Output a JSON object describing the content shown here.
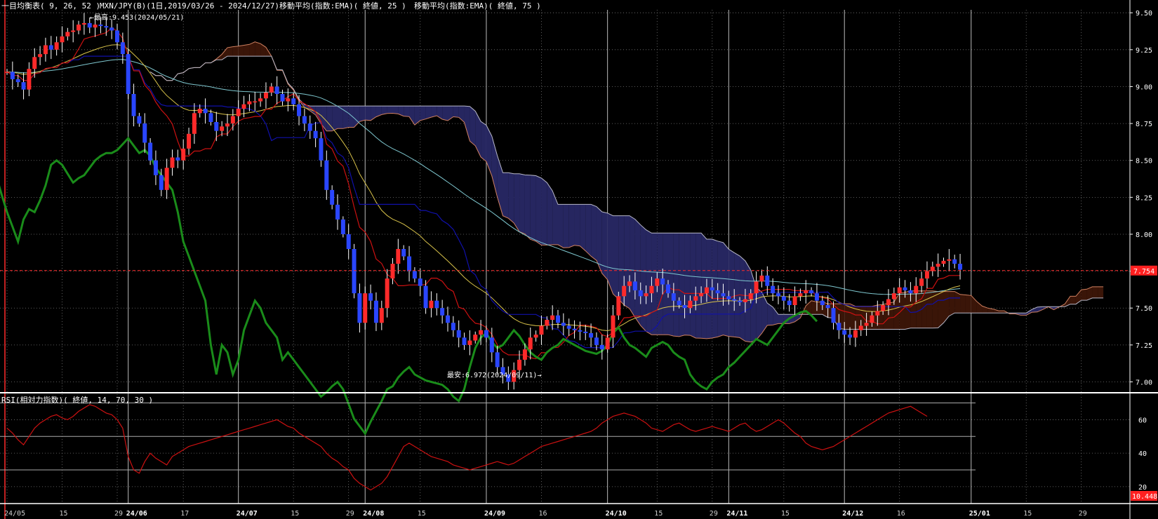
{
  "header": {
    "ichimoku_label": "一目均衡表( 9, 26, 52 )",
    "symbol_label": "MXN/JPY(B)(1日,2019/03/26 - 2024/12/27)",
    "ema25_label": "移動平均(指数:EMA)( 終値, 25 )",
    "ema75_label": "移動平均(指数:EMA)( 終値, 75 )"
  },
  "annotations": {
    "high_label": "←最高:9.453(2024/05/21)",
    "low_label": "最安:6.972(2024/09/11)→"
  },
  "price_badge": "7.754",
  "rsi_header": "RSI(相対力指数)( 終値, 14, 70, 30 )",
  "rsi_badge": "10.448",
  "colors": {
    "background": "#000000",
    "up_candle": "#ff2a2a",
    "down_candle": "#2a46ff",
    "chikou": "#1a8c1a",
    "tenkan": "#cc1111",
    "kijun": "#1010aa",
    "ema25": "#d8c24a",
    "ema75": "#7fc8d0",
    "cloud_bull": "#3a1508",
    "cloud_bear": "#262660",
    "span_a": "#d08060",
    "span_b": "#b8b8c8",
    "rsi_line": "#cc1111",
    "current_price": "#ff2a2a"
  },
  "chart_data": [
    {
      "type": "candlestick",
      "name": "MXN/JPY daily",
      "y_ticks": [
        "9.50",
        "9.25",
        "9.00",
        "8.75",
        "8.50",
        "8.25",
        "8.00",
        "7.75",
        "7.50",
        "7.25",
        "7.00"
      ],
      "ylim": [
        6.95,
        9.52
      ],
      "x_ticks": [
        {
          "label": "24/05",
          "i": 0
        },
        {
          "label": "15",
          "i": 10
        },
        {
          "label": "29",
          "i": 20
        },
        {
          "label": "24/06",
          "i": 22
        },
        {
          "label": "17",
          "i": 32
        },
        {
          "label": "24/07",
          "i": 42
        },
        {
          "label": "15",
          "i": 52
        },
        {
          "label": "29",
          "i": 62
        },
        {
          "label": "24/08",
          "i": 65
        },
        {
          "label": "15",
          "i": 75
        },
        {
          "label": "24/09",
          "i": 87
        },
        {
          "label": "16",
          "i": 97
        },
        {
          "label": "24/10",
          "i": 109
        },
        {
          "label": "15",
          "i": 118
        },
        {
          "label": "29",
          "i": 128
        },
        {
          "label": "24/11",
          "i": 131
        },
        {
          "label": "15",
          "i": 141
        },
        {
          "label": "24/12",
          "i": 152
        },
        {
          "label": "16",
          "i": 162
        },
        {
          "label": "25/01",
          "i": 175
        },
        {
          "label": "15",
          "i": 185
        },
        {
          "label": "29",
          "i": 195
        }
      ],
      "month_boundaries": [
        22,
        42,
        65,
        87,
        109,
        131,
        152,
        175
      ],
      "current_price": 7.754,
      "high": {
        "value": 9.453,
        "date": "2024/05/21"
      },
      "low": {
        "value": 6.972,
        "date": "2024/09/11"
      },
      "close": [
        9.1,
        9.05,
        9.03,
        8.98,
        9.12,
        9.2,
        9.22,
        9.28,
        9.25,
        9.3,
        9.34,
        9.37,
        9.38,
        9.42,
        9.43,
        9.4,
        9.42,
        9.41,
        9.4,
        9.38,
        9.3,
        9.22,
        8.95,
        8.8,
        8.75,
        8.62,
        8.5,
        8.4,
        8.3,
        8.45,
        8.52,
        8.5,
        8.58,
        8.68,
        8.82,
        8.85,
        8.82,
        8.76,
        8.7,
        8.73,
        8.75,
        8.8,
        8.85,
        8.88,
        8.9,
        8.9,
        8.92,
        8.96,
        9.0,
        8.95,
        8.9,
        8.92,
        8.88,
        8.8,
        8.75,
        8.7,
        8.65,
        8.5,
        8.3,
        8.2,
        8.1,
        8.0,
        7.9,
        7.6,
        7.4,
        7.6,
        7.55,
        7.4,
        7.5,
        7.7,
        7.8,
        7.9,
        7.85,
        7.75,
        7.7,
        7.65,
        7.5,
        7.55,
        7.5,
        7.45,
        7.4,
        7.35,
        7.3,
        7.25,
        7.28,
        7.32,
        7.35,
        7.3,
        7.2,
        7.1,
        7.05,
        7.0,
        7.08,
        7.15,
        7.22,
        7.3,
        7.32,
        7.38,
        7.42,
        7.45,
        7.4,
        7.38,
        7.36,
        7.35,
        7.34,
        7.33,
        7.3,
        7.25,
        7.22,
        7.3,
        7.45,
        7.58,
        7.65,
        7.68,
        7.62,
        7.58,
        7.6,
        7.65,
        7.7,
        7.66,
        7.6,
        7.55,
        7.52,
        7.5,
        7.55,
        7.58,
        7.6,
        7.64,
        7.62,
        7.6,
        7.58,
        7.56,
        7.55,
        7.54,
        7.56,
        7.6,
        7.68,
        7.72,
        7.65,
        7.6,
        7.58,
        7.55,
        7.52,
        7.58,
        7.6,
        7.62,
        7.6,
        7.55,
        7.52,
        7.5,
        7.4,
        7.35,
        7.32,
        7.3,
        7.35,
        7.38,
        7.4,
        7.45,
        7.48,
        7.52,
        7.56,
        7.6,
        7.64,
        7.62,
        7.6,
        7.65,
        7.7,
        7.75,
        7.78,
        7.8,
        7.82,
        7.83,
        7.8,
        7.76
      ]
    },
    {
      "type": "line",
      "name": "RSI",
      "y_ticks": [
        "60",
        "40",
        "20"
      ],
      "ylim": [
        12,
        74
      ],
      "levels": [
        70,
        50,
        30
      ],
      "values": [
        55,
        52,
        48,
        45,
        50,
        55,
        58,
        60,
        62,
        63,
        61,
        60,
        62,
        65,
        67,
        69,
        68,
        66,
        64,
        63,
        60,
        55,
        38,
        30,
        28,
        35,
        40,
        37,
        35,
        33,
        38,
        40,
        42,
        44,
        45,
        46,
        47,
        48,
        49,
        50,
        51,
        52,
        53,
        54,
        55,
        56,
        57,
        58,
        59,
        60,
        58,
        56,
        55,
        52,
        50,
        48,
        46,
        44,
        40,
        37,
        35,
        32,
        30,
        25,
        22,
        20,
        18,
        20,
        22,
        26,
        32,
        38,
        44,
        46,
        44,
        42,
        40,
        38,
        37,
        36,
        35,
        33,
        32,
        31,
        30,
        31,
        32,
        33,
        34,
        35,
        34,
        33,
        34,
        36,
        38,
        40,
        42,
        44,
        45,
        46,
        47,
        48,
        49,
        50,
        51,
        52,
        53,
        55,
        58,
        60,
        62,
        63,
        64,
        63,
        62,
        60,
        58,
        55,
        54,
        53,
        55,
        57,
        58,
        56,
        54,
        53,
        54,
        55,
        56,
        55,
        54,
        53,
        55,
        57,
        58,
        55,
        53,
        54,
        56,
        58,
        60,
        58,
        55,
        52,
        50,
        46,
        44,
        43,
        42,
        43,
        44,
        46,
        48,
        50,
        52,
        54,
        56,
        58,
        60,
        62,
        64,
        65,
        66,
        67,
        68,
        66,
        64,
        62
      ]
    }
  ]
}
